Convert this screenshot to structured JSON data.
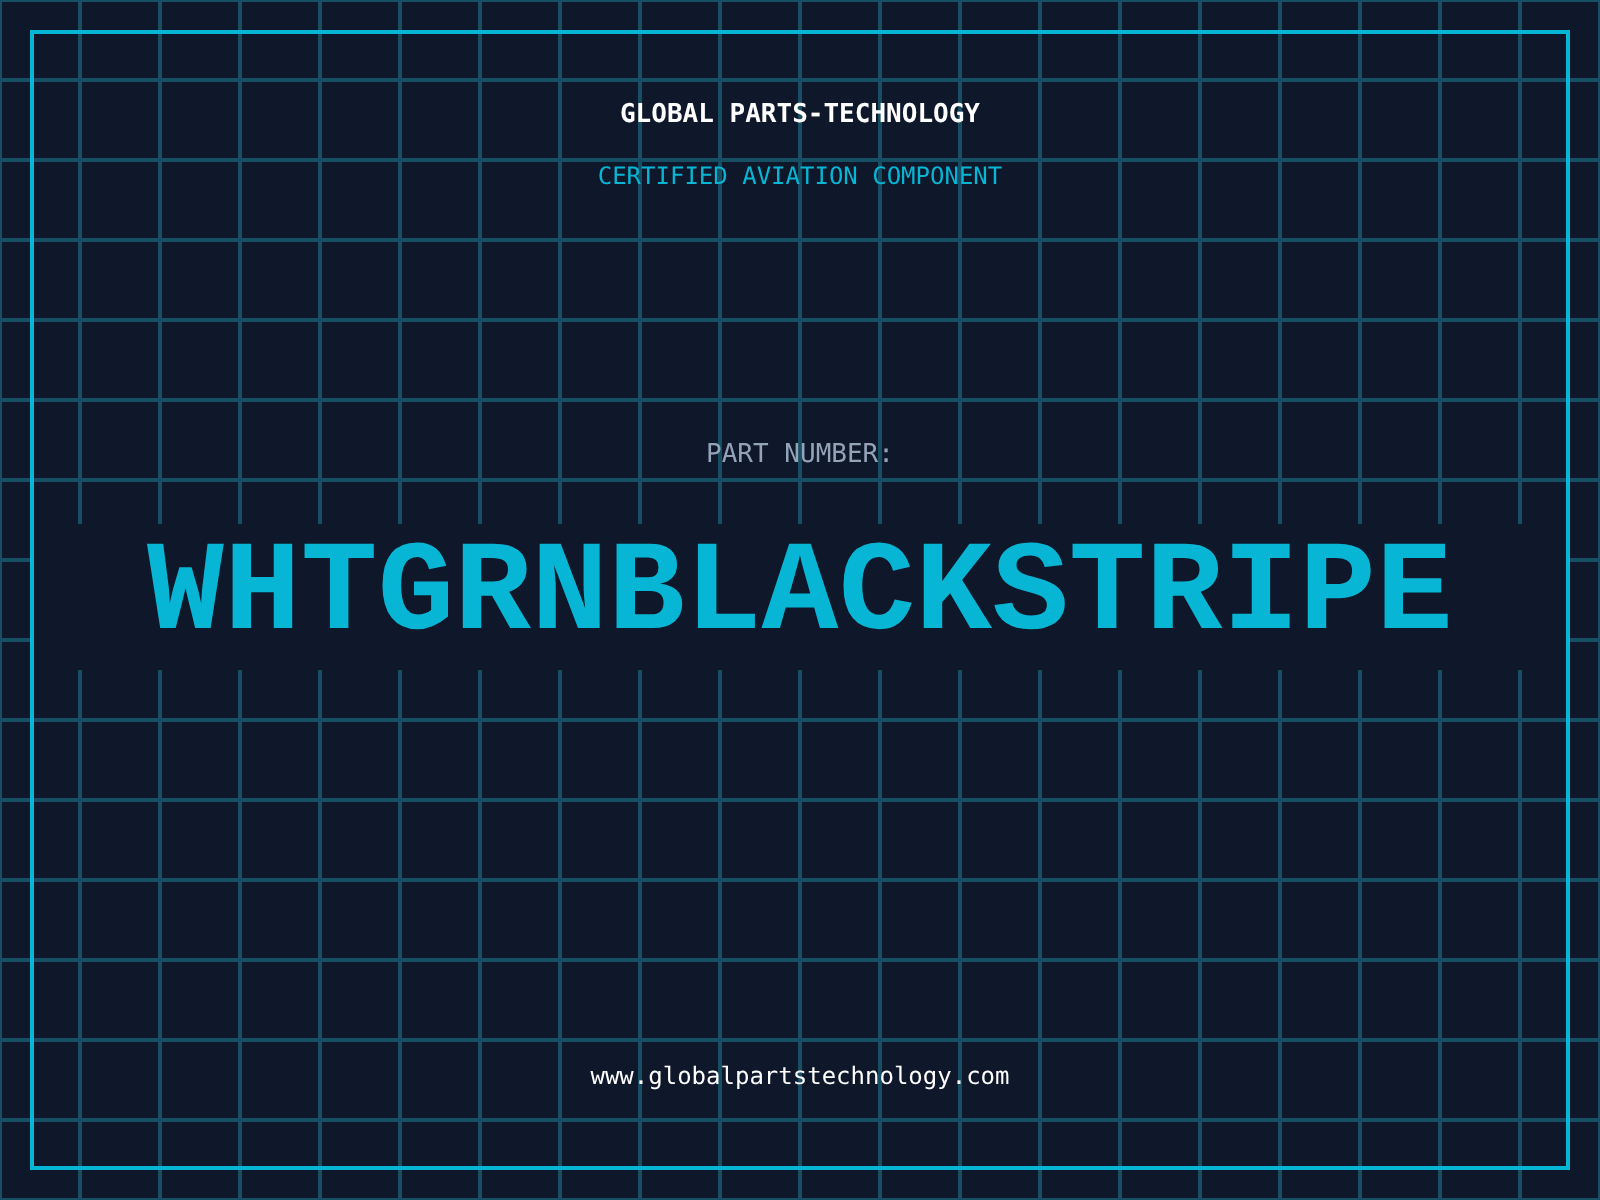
{
  "header": {
    "title": "GLOBAL PARTS-TECHNOLOGY",
    "subtitle": "CERTIFIED AVIATION COMPONENT"
  },
  "part": {
    "label": "PART NUMBER:",
    "number": "WHTGRNBLACKSTRIPE"
  },
  "footer": {
    "url": "www.globalpartstechnology.com"
  }
}
